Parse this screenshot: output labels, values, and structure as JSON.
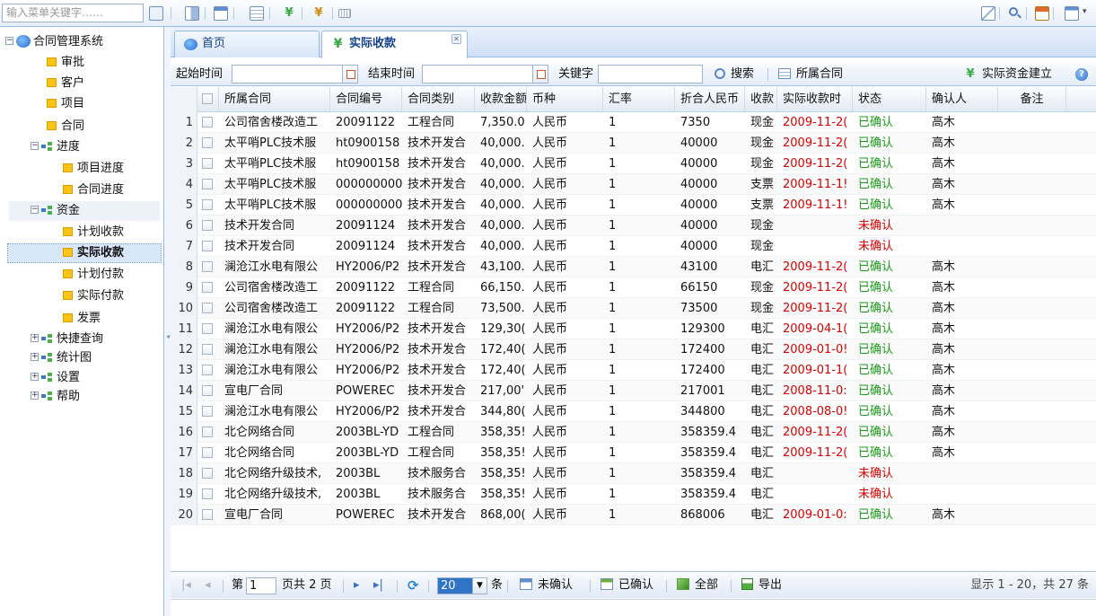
{
  "toolbar": {
    "search_placeholder": "输入菜单关键字……",
    "icons": [
      "fullscreen-icon",
      "list-icon",
      "layout-icon",
      "table-icon",
      "yen-icon",
      "yen-icon",
      "keyboard-icon"
    ],
    "right_icons": [
      "mail-icon",
      "search-icon",
      "calculator-icon",
      "window-icon"
    ]
  },
  "tree": {
    "root": "合同管理系统",
    "items": [
      {
        "label": "审批"
      },
      {
        "label": "客户"
      },
      {
        "label": "项目"
      },
      {
        "label": "合同"
      },
      {
        "label": "进度"
      },
      {
        "label": "项目进度"
      },
      {
        "label": "合同进度"
      },
      {
        "label": "资金"
      },
      {
        "label": "计划收款"
      },
      {
        "label": "实际收款"
      },
      {
        "label": "计划付款"
      },
      {
        "label": "实际付款"
      },
      {
        "label": "发票"
      },
      {
        "label": "快捷查询"
      },
      {
        "label": "统计图"
      },
      {
        "label": "设置"
      },
      {
        "label": "帮助"
      }
    ]
  },
  "tabs": {
    "home": "首页",
    "active": "实际收款"
  },
  "filter": {
    "start_label": "起始时间",
    "end_label": "结束时间",
    "keyword_label": "关键字",
    "search_button": "搜索",
    "contract_button": "所属合同",
    "create_button": "实际资金建立"
  },
  "grid": {
    "headers": [
      "所属合同",
      "合同编号",
      "合同类别",
      "收款金额",
      "币种",
      "汇率",
      "折合人民币",
      "收款",
      "实际收款时",
      "状态",
      "确认人",
      "备注"
    ],
    "rows": [
      [
        "1",
        "公司宿舍楼改造工",
        "20091122",
        "工程合同",
        "7,350.0",
        "人民币",
        "1",
        "7350",
        "现金",
        "2009-11-2(",
        "已确认",
        "高木",
        ""
      ],
      [
        "2",
        "太平哨PLC技术服",
        "ht0900158",
        "技术开发合",
        "40,000.",
        "人民币",
        "1",
        "40000",
        "现金",
        "2009-11-2(",
        "已确认",
        "高木",
        ""
      ],
      [
        "3",
        "太平哨PLC技术服",
        "ht0900158",
        "技术开发合",
        "40,000.",
        "人民币",
        "1",
        "40000",
        "现金",
        "2009-11-2(",
        "已确认",
        "高木",
        ""
      ],
      [
        "4",
        "太平哨PLC技术服",
        "000000000(",
        "技术开发合",
        "40,000.",
        "人民币",
        "1",
        "40000",
        "支票",
        "2009-11-1!",
        "已确认",
        "高木",
        ""
      ],
      [
        "5",
        "太平哨PLC技术服",
        "000000000(",
        "技术开发合",
        "40,000.",
        "人民币",
        "1",
        "40000",
        "支票",
        "2009-11-1!",
        "已确认",
        "高木",
        ""
      ],
      [
        "6",
        "技术开发合同",
        "20091124",
        "技术开发合",
        "40,000.",
        "人民币",
        "1",
        "40000",
        "现金",
        "",
        "未确认",
        "",
        ""
      ],
      [
        "7",
        "技术开发合同",
        "20091124",
        "技术开发合",
        "40,000.",
        "人民币",
        "1",
        "40000",
        "现金",
        "",
        "未确认",
        "",
        ""
      ],
      [
        "8",
        "澜沧江水电有限公",
        "HY2006/P2",
        "技术开发合",
        "43,100.",
        "人民币",
        "1",
        "43100",
        "电汇",
        "2009-11-2(",
        "已确认",
        "高木",
        ""
      ],
      [
        "9",
        "公司宿舍楼改造工",
        "20091122",
        "工程合同",
        "66,150.",
        "人民币",
        "1",
        "66150",
        "现金",
        "2009-11-2(",
        "已确认",
        "高木",
        ""
      ],
      [
        "10",
        "公司宿舍楼改造工",
        "20091122",
        "工程合同",
        "73,500.",
        "人民币",
        "1",
        "73500",
        "现金",
        "2009-11-2(",
        "已确认",
        "高木",
        ""
      ],
      [
        "11",
        "澜沧江水电有限公",
        "HY2006/P2",
        "技术开发合",
        "129,30(",
        "人民币",
        "1",
        "129300",
        "电汇",
        "2009-04-1(",
        "已确认",
        "高木",
        ""
      ],
      [
        "12",
        "澜沧江水电有限公",
        "HY2006/P2",
        "技术开发合",
        "172,40(",
        "人民币",
        "1",
        "172400",
        "电汇",
        "2009-01-0!",
        "已确认",
        "高木",
        ""
      ],
      [
        "13",
        "澜沧江水电有限公",
        "HY2006/P2",
        "技术开发合",
        "172,40(",
        "人民币",
        "1",
        "172400",
        "电汇",
        "2009-01-1(",
        "已确认",
        "高木",
        ""
      ],
      [
        "14",
        "宣电厂合同",
        "POWEREC",
        "技术开发合",
        "217,00'",
        "人民币",
        "1",
        "217001",
        "电汇",
        "2008-11-0:",
        "已确认",
        "高木",
        ""
      ],
      [
        "15",
        "澜沧江水电有限公",
        "HY2006/P2",
        "技术开发合",
        "344,80(",
        "人民币",
        "1",
        "344800",
        "电汇",
        "2008-08-0!",
        "已确认",
        "高木",
        ""
      ],
      [
        "16",
        "北仑网络合同",
        "2003BL-YD",
        "工程合同",
        "358,35!",
        "人民币",
        "1",
        "358359.4",
        "电汇",
        "2009-11-2(",
        "已确认",
        "高木",
        ""
      ],
      [
        "17",
        "北仑网络合同",
        "2003BL-YD",
        "工程合同",
        "358,35!",
        "人民币",
        "1",
        "358359.4",
        "电汇",
        "2009-11-2(",
        "已确认",
        "高木",
        ""
      ],
      [
        "18",
        "北仑网络升级技术,",
        "2003BL",
        "技术服务合",
        "358,35!",
        "人民币",
        "1",
        "358359.4",
        "电汇",
        "",
        "未确认",
        "",
        ""
      ],
      [
        "19",
        "北仑网络升级技术,",
        "2003BL",
        "技术服务合",
        "358,35!",
        "人民币",
        "1",
        "358359.4",
        "电汇",
        "",
        "未确认",
        "",
        ""
      ],
      [
        "20",
        "宣电厂合同",
        "POWEREC",
        "技术开发合",
        "868,00(",
        "人民币",
        "1",
        "868006",
        "电汇",
        "2009-01-0:",
        "已确认",
        "高木",
        ""
      ]
    ]
  },
  "pager": {
    "page_prefix": "第",
    "page_value": "1",
    "page_suffix": "页共 2 页",
    "page_size": "20",
    "page_size_unit": "条",
    "unconfirmed": "未确认",
    "confirmed": "已确认",
    "all": "全部",
    "export": "导出",
    "summary": "显示 1 - 20，共 27 条"
  },
  "colors": {
    "accent": "#15428b",
    "border": "#99bbe8",
    "date_red": "#d80000",
    "confirmed_green": "#1a9a1a",
    "unconfirmed_red": "#d80000"
  }
}
